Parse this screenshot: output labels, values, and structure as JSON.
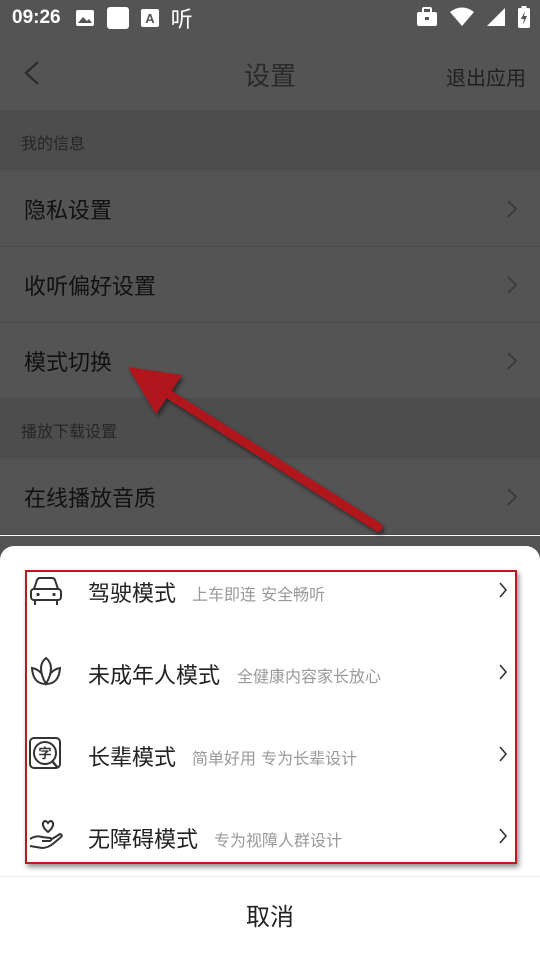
{
  "status_bar": {
    "time": "09:26",
    "left_icons": [
      "image-icon",
      "white-square-icon",
      "text-a-icon",
      "ting-icon"
    ],
    "ting_glyph": "听",
    "right_icons": [
      "briefcase-icon",
      "wifi-icon",
      "signal-icon",
      "battery-charging-icon"
    ]
  },
  "header": {
    "title": "设置",
    "exit_label": "退出应用"
  },
  "settings": {
    "sections": [
      {
        "title": "我的信息",
        "items": [
          {
            "label": "隐私设置"
          },
          {
            "label": "收听偏好设置"
          },
          {
            "label": "模式切换"
          }
        ]
      },
      {
        "title": "播放下载设置",
        "items": [
          {
            "label": "在线播放音质"
          }
        ]
      }
    ]
  },
  "mode_sheet": {
    "modes": [
      {
        "title": "驾驶模式",
        "desc": "上车即连  安全畅听",
        "icon": "car-icon"
      },
      {
        "title": "未成年人模式",
        "desc": "全健康内容家长放心",
        "icon": "leaf-icon"
      },
      {
        "title": "长辈模式",
        "desc": "简单好用  专为长辈设计",
        "icon": "zi-magnifier-icon"
      },
      {
        "title": "无障碍模式",
        "desc": "专为视障人群设计",
        "icon": "heart-hand-icon"
      }
    ],
    "zi_glyph": "字",
    "cancel_label": "取消"
  },
  "colors": {
    "annotation_red": "#c0161e",
    "overlay_dim": "#545454"
  }
}
